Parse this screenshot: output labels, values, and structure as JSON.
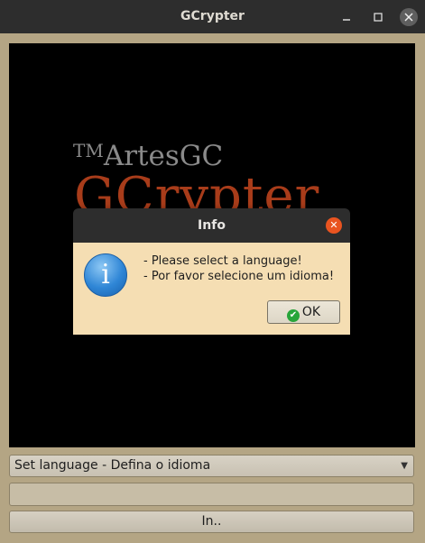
{
  "window": {
    "title": "GCrypter",
    "minimize_glyph": "_",
    "maximize_glyph": "▢",
    "close_glyph": "✕"
  },
  "splash": {
    "tm": "TM",
    "brand": "ArtesGC",
    "product": "GCrypter"
  },
  "dialog": {
    "title": "Info",
    "close_glyph": "✕",
    "icon_glyph": "i",
    "message_lines": [
      "- Please select a language!",
      "- Por favor selecione um idioma!"
    ],
    "ok_label": "OK"
  },
  "controls": {
    "language_select": {
      "selected": "Set language - Defina o idioma",
      "arrow": "▼"
    },
    "text_field": {
      "value": ""
    },
    "in_button": "In.."
  },
  "colors": {
    "accent_close": "#e95420",
    "background": "#b4a584",
    "dialog_bg": "#f5deb3",
    "product_red": "#a83c1a"
  }
}
